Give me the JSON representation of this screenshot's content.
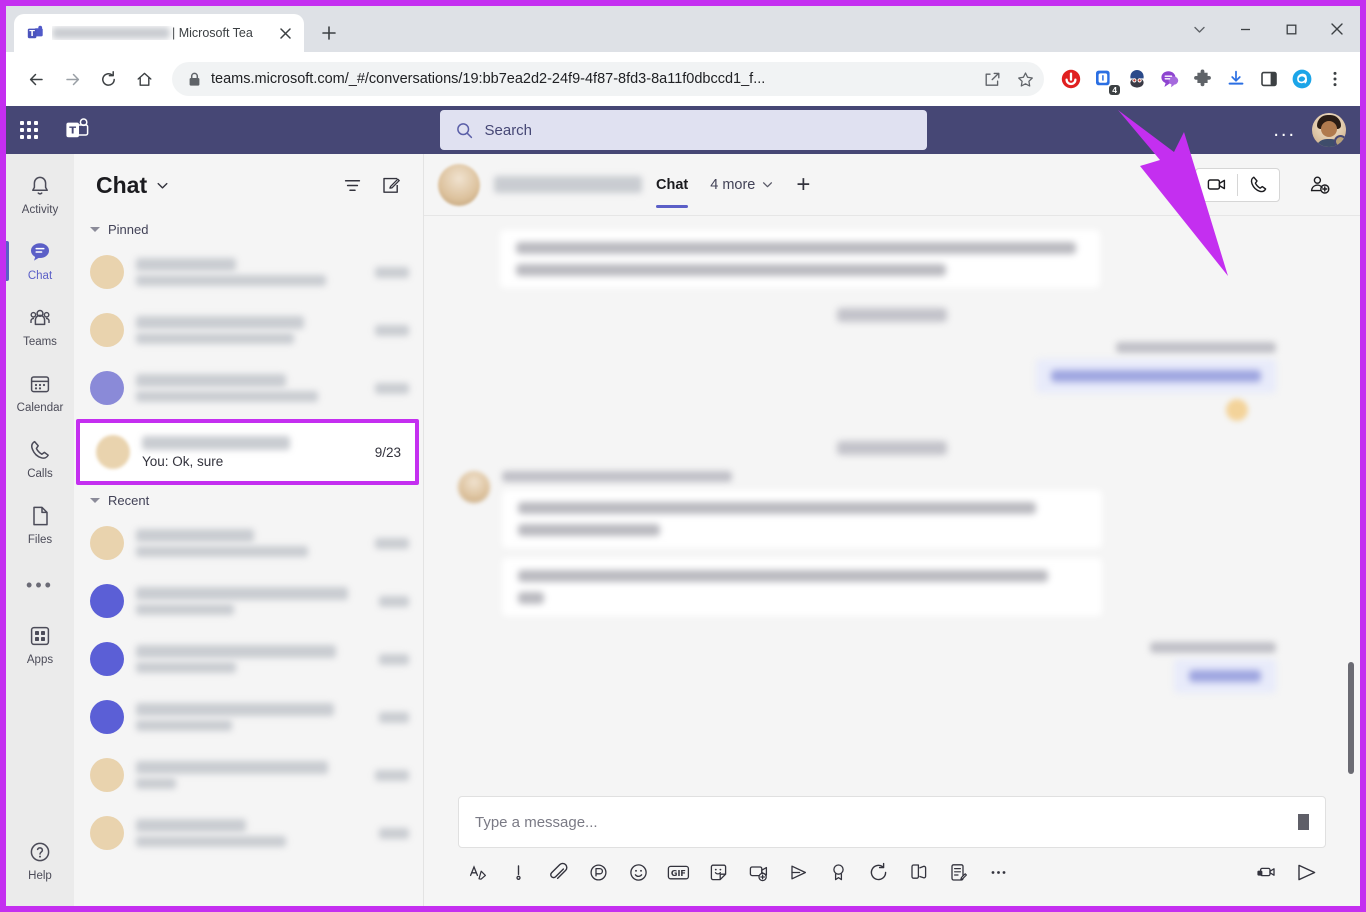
{
  "browser": {
    "tab": {
      "favicon_icon": "teams-favicon",
      "title_redacted": "████████████",
      "title_visible": "| Microsoft Tea",
      "close_icon": "close-icon"
    },
    "new_tab_label": "+",
    "window_controls": [
      {
        "name": "tab-search",
        "icon": "chevron-down-icon"
      },
      {
        "name": "minimize",
        "icon": "minimize-icon"
      },
      {
        "name": "maximize",
        "icon": "maximize-icon"
      },
      {
        "name": "close",
        "icon": "close-icon"
      }
    ],
    "nav": {
      "back_icon": "back-arrow-icon",
      "forward_icon": "forward-arrow-icon",
      "reload_icon": "reload-icon",
      "home_icon": "home-icon"
    },
    "omnibox": {
      "lock_icon": "lock-icon",
      "url": "teams.microsoft.com/_#/conversations/19:bb7ea2d2-24f9-4f87-8fd3-8a11f0dbccd1_f...",
      "share_icon": "share-icon",
      "bookmark_icon": "star-icon"
    },
    "extensions": [
      {
        "name": "adblock-extension-icon",
        "badge": ""
      },
      {
        "name": "notes-extension-icon",
        "badge": "4"
      },
      {
        "name": "avatar-extension-icon",
        "badge": ""
      },
      {
        "name": "chat-extension-icon",
        "badge": ""
      },
      {
        "name": "puzzle-extensions-icon",
        "badge": ""
      },
      {
        "name": "downloads-icon",
        "badge": ""
      },
      {
        "name": "sidepanel-icon",
        "badge": ""
      },
      {
        "name": "sider-extension-icon",
        "badge": ""
      },
      {
        "name": "chrome-menu-icon",
        "badge": ""
      }
    ]
  },
  "teams": {
    "topbar": {
      "waffle_icon": "app-grid-icon",
      "logo_icon": "teams-logo-icon",
      "search": {
        "placeholder": "Search",
        "value": "",
        "icon": "search-icon"
      },
      "more_label": "...",
      "avatar": {
        "name": "user-avatar",
        "status": "away"
      }
    },
    "rail": [
      {
        "label": "Activity",
        "icon": "bell-icon",
        "active": false
      },
      {
        "label": "Chat",
        "icon": "chat-bubble-icon",
        "active": true
      },
      {
        "label": "Teams",
        "icon": "people-icon",
        "active": false
      },
      {
        "label": "Calendar",
        "icon": "calendar-icon",
        "active": false
      },
      {
        "label": "Calls",
        "icon": "phone-icon",
        "active": false
      },
      {
        "label": "Files",
        "icon": "file-icon",
        "active": false
      },
      {
        "label": "Apps",
        "icon": "apps-grid-icon",
        "active": false
      },
      {
        "label": "Help",
        "icon": "question-circle-icon",
        "active": false
      }
    ],
    "rail_overflow_label": "•••",
    "chatlist": {
      "title": "Chat",
      "title_chevron_icon": "chevron-down-icon",
      "filter_icon": "filter-icon",
      "compose_icon": "compose-chat-icon",
      "sections": [
        {
          "label": "Pinned"
        },
        {
          "label": "Recent"
        }
      ],
      "pinned_items": [
        {
          "avatar": "tan",
          "name": "",
          "preview": "",
          "time": ""
        },
        {
          "avatar": "tan",
          "name": "",
          "preview": "",
          "time": ""
        },
        {
          "avatar": "blue",
          "name": "",
          "preview": "",
          "time": ""
        }
      ],
      "selected_item": {
        "avatar": "tan",
        "name": "",
        "preview": "You: Ok, sure",
        "time": "9/23",
        "highlighted": true
      },
      "recent_items": [
        {
          "avatar": "tan",
          "name": "",
          "preview": "",
          "time": ""
        },
        {
          "avatar": "blue",
          "name": "",
          "preview": "",
          "time": ""
        },
        {
          "avatar": "blue",
          "name": "",
          "preview": "",
          "time": ""
        },
        {
          "avatar": "blue",
          "name": "",
          "preview": "",
          "time": ""
        },
        {
          "avatar": "tan",
          "name": "",
          "preview": "",
          "time": ""
        },
        {
          "avatar": "tan",
          "name": "",
          "preview": "",
          "time": ""
        }
      ]
    },
    "conversation": {
      "contact_name_redacted": "████████████",
      "tabs": [
        {
          "label": "Chat",
          "active": true
        },
        {
          "label": "4 more",
          "active": false,
          "chevron_icon": "chevron-down-icon"
        }
      ],
      "add_tab_label": "+",
      "actions": [
        {
          "name": "video-call-button",
          "icon": "video-camera-icon"
        },
        {
          "name": "audio-call-button",
          "icon": "phone-icon"
        },
        {
          "name": "add-people-button",
          "icon": "person-add-icon"
        }
      ]
    },
    "composer": {
      "placeholder": "Type a message...",
      "value": "",
      "tools": [
        {
          "name": "format-button",
          "icon": "format-text-icon"
        },
        {
          "name": "importance-button",
          "icon": "exclamation-icon"
        },
        {
          "name": "attach-button",
          "icon": "paperclip-icon"
        },
        {
          "name": "loop-button",
          "icon": "loop-component-icon"
        },
        {
          "name": "emoji-button",
          "icon": "emoji-icon"
        },
        {
          "name": "giphy-button",
          "icon": "gif-icon"
        },
        {
          "name": "sticker-button",
          "icon": "sticker-icon"
        },
        {
          "name": "meet-now-button",
          "icon": "meet-now-icon"
        },
        {
          "name": "stream-button",
          "icon": "stream-icon"
        },
        {
          "name": "praise-button",
          "icon": "praise-badge-icon"
        },
        {
          "name": "schedule-button",
          "icon": "schedule-icon"
        },
        {
          "name": "approvals-button",
          "icon": "approvals-icon"
        },
        {
          "name": "forms-button",
          "icon": "forms-icon"
        },
        {
          "name": "more-options-button",
          "icon": "ellipsis-icon"
        }
      ],
      "right_tools": [
        {
          "name": "video-clip-button",
          "icon": "video-clip-icon"
        },
        {
          "name": "send-button",
          "icon": "send-icon"
        }
      ]
    }
  },
  "annotation": {
    "highlight_color": "#c42ff0",
    "arrow_target": "chat-extension-icon"
  }
}
